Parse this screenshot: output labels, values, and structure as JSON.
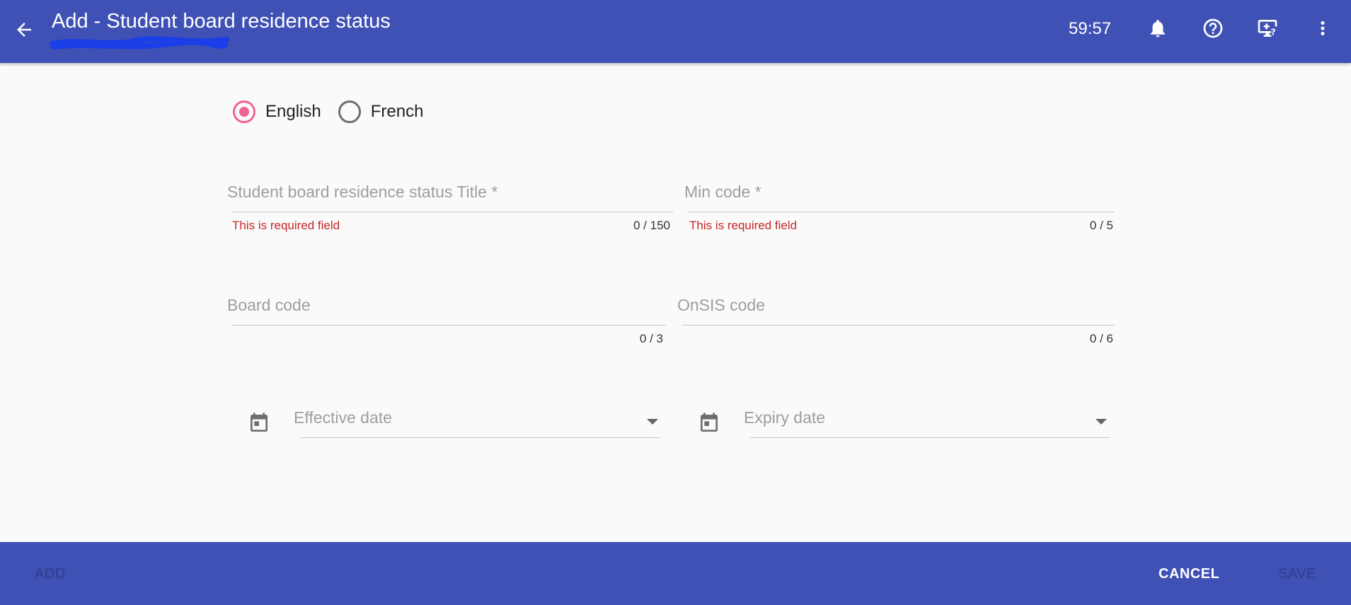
{
  "header": {
    "title": "Add - Student board residence status",
    "timer": "59:57",
    "icons": [
      "arrow-back-icon",
      "bell-icon",
      "help-icon",
      "screen-help-icon",
      "more-vert-icon"
    ]
  },
  "language": {
    "options": [
      {
        "label": "English",
        "selected": true
      },
      {
        "label": "French",
        "selected": false
      }
    ]
  },
  "form": {
    "title_field": {
      "label": "Student board residence status Title *",
      "error": "This is required field",
      "counter": "0 / 150"
    },
    "min_code": {
      "label": "Min code *",
      "error": "This is required field",
      "counter": "0 / 5"
    },
    "board_code": {
      "label": "Board code",
      "counter": "0 / 3"
    },
    "onsis_code": {
      "label": "OnSIS code",
      "counter": "0 / 6"
    },
    "effective_date": {
      "label": "Effective date"
    },
    "expiry_date": {
      "label": "Expiry date"
    }
  },
  "footer": {
    "add_label": "ADD",
    "cancel_label": "CANCEL",
    "save_label": "SAVE"
  },
  "colors": {
    "primary": "#3f51b5",
    "accent": "#f06292",
    "error": "#c62828"
  }
}
